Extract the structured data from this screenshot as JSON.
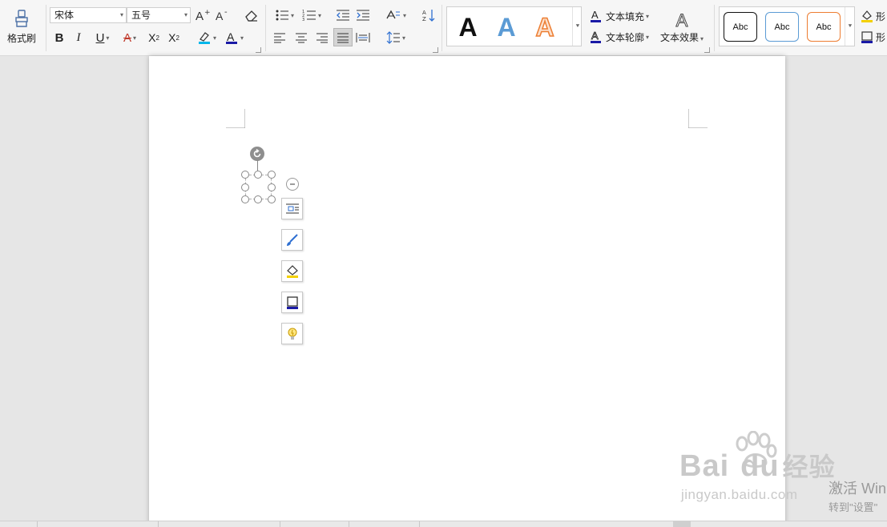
{
  "ribbon": {
    "format_painter_label": "格式刷",
    "font_name": "宋体",
    "font_size": "五号",
    "text_fill_label": "文本填充",
    "text_outline_label": "文本轮廓",
    "text_effect_label": "文本效果",
    "wordart_glyph": "A",
    "style_samples": [
      "Abc",
      "Abc",
      "Abc"
    ],
    "shape_fill_label": "形",
    "shape_outline_label": "形"
  },
  "colors": {
    "highlight": "#00b7eb",
    "font_color": "#1a1aa6",
    "wordart_blue": "#5b9bd5",
    "wordart_orange": "#ed7d31",
    "selection": "#888888"
  },
  "watermark": {
    "brand": "Bai",
    "brand_end": "du",
    "brand_cn": "经验",
    "url": "jingyan.baidu.com"
  },
  "activation": {
    "title": "激活 Win",
    "subtitle": "转到\"设置\""
  }
}
